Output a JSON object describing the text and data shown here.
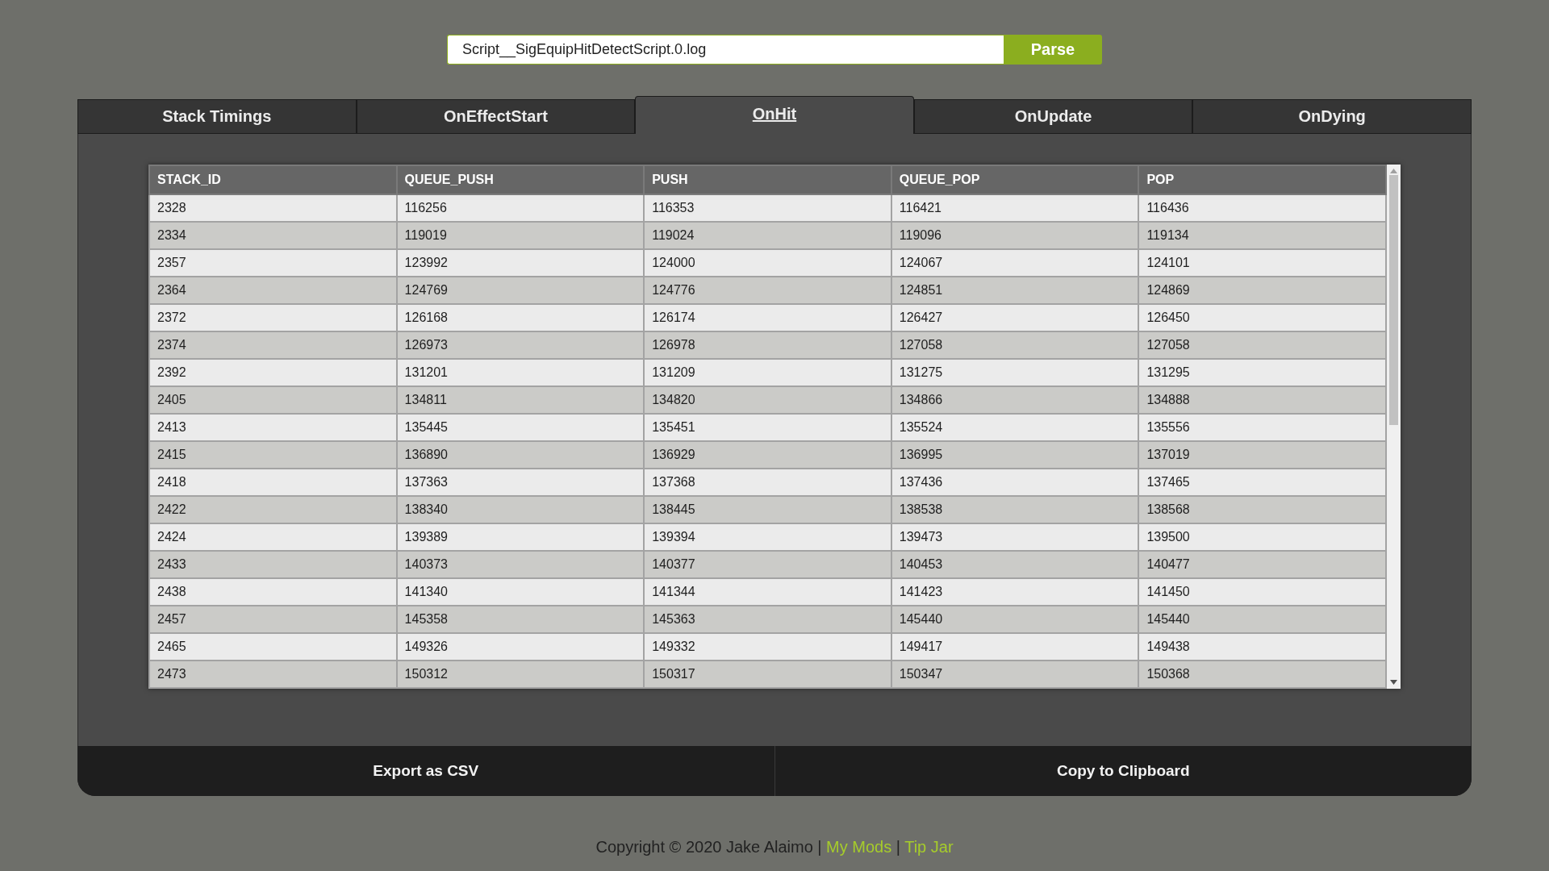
{
  "file_input": {
    "value": "Script__SigEquipHitDetectScript.0.log"
  },
  "parse_button": "Parse",
  "tabs": [
    {
      "label": "Stack Timings",
      "selected": false
    },
    {
      "label": "OnEffectStart",
      "selected": false
    },
    {
      "label": "OnHit",
      "selected": true
    },
    {
      "label": "OnUpdate",
      "selected": false
    },
    {
      "label": "OnDying",
      "selected": false
    }
  ],
  "table": {
    "columns": [
      "STACK_ID",
      "QUEUE_PUSH",
      "PUSH",
      "QUEUE_POP",
      "POP"
    ],
    "rows": [
      [
        "2328",
        "116256",
        "116353",
        "116421",
        "116436"
      ],
      [
        "2334",
        "119019",
        "119024",
        "119096",
        "119134"
      ],
      [
        "2357",
        "123992",
        "124000",
        "124067",
        "124101"
      ],
      [
        "2364",
        "124769",
        "124776",
        "124851",
        "124869"
      ],
      [
        "2372",
        "126168",
        "126174",
        "126427",
        "126450"
      ],
      [
        "2374",
        "126973",
        "126978",
        "127058",
        "127058"
      ],
      [
        "2392",
        "131201",
        "131209",
        "131275",
        "131295"
      ],
      [
        "2405",
        "134811",
        "134820",
        "134866",
        "134888"
      ],
      [
        "2413",
        "135445",
        "135451",
        "135524",
        "135556"
      ],
      [
        "2415",
        "136890",
        "136929",
        "136995",
        "137019"
      ],
      [
        "2418",
        "137363",
        "137368",
        "137436",
        "137465"
      ],
      [
        "2422",
        "138340",
        "138445",
        "138538",
        "138568"
      ],
      [
        "2424",
        "139389",
        "139394",
        "139473",
        "139500"
      ],
      [
        "2433",
        "140373",
        "140377",
        "140453",
        "140477"
      ],
      [
        "2438",
        "141340",
        "141344",
        "141423",
        "141450"
      ],
      [
        "2457",
        "145358",
        "145363",
        "145440",
        "145440"
      ],
      [
        "2465",
        "149326",
        "149332",
        "149417",
        "149438"
      ],
      [
        "2473",
        "150312",
        "150317",
        "150347",
        "150368"
      ]
    ]
  },
  "actions": [
    "Export as CSV",
    "Copy to Clipboard"
  ],
  "footer": [
    {
      "kind": "text",
      "text": "Copyright © 2020 Jake Alaimo |"
    },
    {
      "kind": "link",
      "text": "My Mods"
    },
    {
      "kind": "text",
      "text": "|"
    },
    {
      "kind": "link",
      "text": "Tip Jar"
    }
  ]
}
